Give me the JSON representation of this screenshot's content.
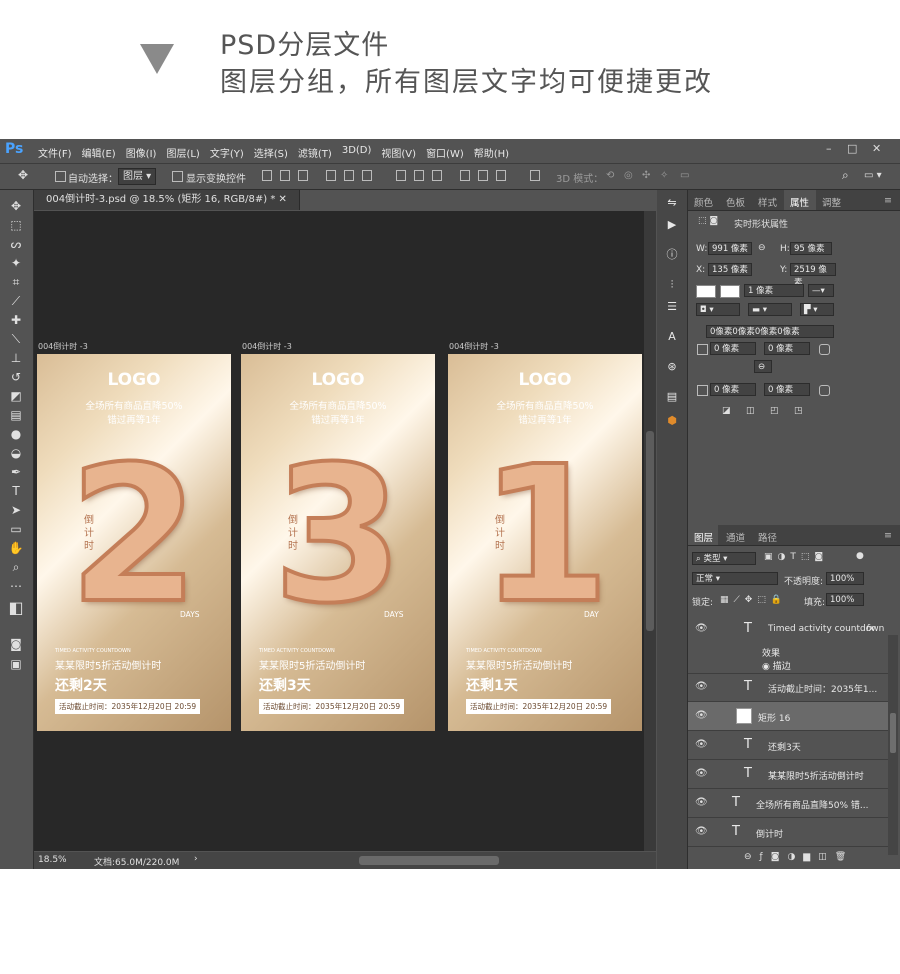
{
  "header": {
    "line1": "PSD分层文件",
    "line2": "图层分组，所有图层文字均可便捷更改"
  },
  "app": {
    "logo": "Ps",
    "menu": [
      "文件(F)",
      "编辑(E)",
      "图像(I)",
      "图层(L)",
      "文字(Y)",
      "选择(S)",
      "滤镜(T)",
      "3D(D)",
      "视图(V)",
      "窗口(W)",
      "帮助(H)"
    ],
    "options": {
      "auto_select": "自动选择：",
      "select_value": "图层",
      "show_transform": "显示变换控件",
      "mode3d": "3D 模式："
    },
    "doc_tab": "004倒计时-3.psd @ 18.5% (矩形 16, RGB/8#) *",
    "status": {
      "zoom": "18.5%",
      "doc": "文档:65.0M/220.0M"
    }
  },
  "artboards": [
    {
      "label": "004倒计时 -3",
      "logo": "LOGO",
      "sub1": "全场所有商品直降50%",
      "sub2": "错过再等1年",
      "number": "2",
      "vertical": "倒计时",
      "unit": "DAYS",
      "en": "TIMED ACTIVITY COUNTDOWN",
      "cn1": "某某限时5折活动倒计时",
      "cn2": "还剩2天",
      "deadline": "活动截止时间：2035年12月20日  20:59"
    },
    {
      "label": "004倒计时 -3",
      "logo": "LOGO",
      "sub1": "全场所有商品直降50%",
      "sub2": "错过再等1年",
      "number": "3",
      "vertical": "倒计时",
      "unit": "DAYS",
      "en": "TIMED ACTIVITY COUNTDOWN",
      "cn1": "某某限时5折活动倒计时",
      "cn2": "还剩3天",
      "deadline": "活动截止时间：2035年12月20日  20:59"
    },
    {
      "label": "004倒计时 -3",
      "logo": "LOGO",
      "sub1": "全场所有商品直降50%",
      "sub2": "错过再等1年",
      "number": "1",
      "vertical": "倒计时",
      "unit": "DAY",
      "en": "TIMED ACTIVITY COUNTDOWN",
      "cn1": "某某限时5折活动倒计时",
      "cn2": "还剩1天",
      "deadline": "活动截止时间：2035年12月20日  20:59"
    }
  ],
  "properties": {
    "tabs": [
      "颜色",
      "色板",
      "样式",
      "属性",
      "调整"
    ],
    "title": "实时形状属性",
    "w_label": "W:",
    "w": "991 像素",
    "h_label": "H:",
    "h": "95 像素",
    "x_label": "X:",
    "x": "135 像素",
    "y_label": "Y:",
    "y": "2519 像素",
    "stroke": "1 像素",
    "radius_all": "0像素0像素0像素0像素",
    "r1": "0 像素",
    "r2": "0 像素",
    "r3": "0 像素",
    "r4": "0 像素"
  },
  "layers": {
    "tabs": [
      "图层",
      "通道",
      "路径"
    ],
    "filter": "类型",
    "blend": "正常",
    "opacity_label": "不透明度:",
    "opacity": "100%",
    "lock_label": "锁定:",
    "fill_label": "填充:",
    "fill": "100%",
    "effects_label": "效果",
    "stroke_effect": "描边",
    "items": [
      "Timed activity countdown",
      "活动截止时间：2035年1...",
      "矩形 16",
      "还剩3天",
      "某某限时5折活动倒计时",
      "全场所有商品直降50% 错...",
      "倒计时"
    ]
  },
  "icons": {
    "eye": "eye-icon",
    "type": "text-layer-icon",
    "fx": "fx-icon"
  }
}
